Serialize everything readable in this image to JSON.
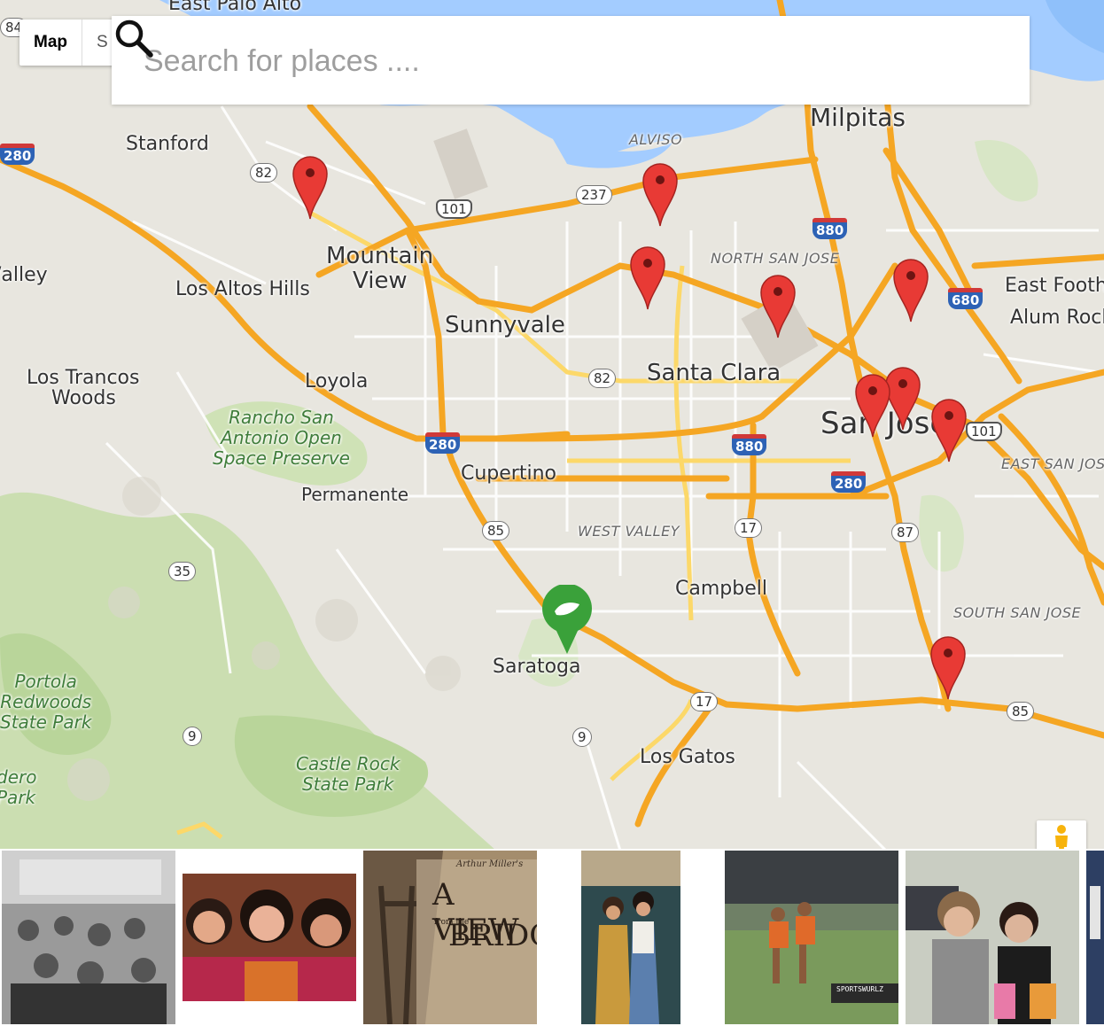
{
  "map_type": {
    "active": "Map",
    "second": "S"
  },
  "search": {
    "placeholder": "Search for places ....",
    "value": ""
  },
  "places": {
    "east_palo_alto": "East Palo Alto",
    "stanford": "Stanford",
    "milpitas": "Milpitas",
    "alviso": "ALVISO",
    "mountain_view_1": "Mountain",
    "mountain_view_2": "View",
    "valley": "/alley",
    "los_altos_hills": "Los Altos Hills",
    "north_san_jose": "NORTH SAN JOSE",
    "east_foothills": "East Foothi",
    "alum_rock": "Alum Rock",
    "sunnyvale": "Sunnyvale",
    "los_trancos_1": "Los Trancos",
    "los_trancos_2": "Woods",
    "loyola": "Loyola",
    "santa_clara": "Santa Clara",
    "rancho": "Rancho San\nAntonio Open\nSpace Preserve",
    "san_jose": "San Jose",
    "east_san_jose": "EAST SAN JOS",
    "cupertino": "Cupertino",
    "permanente": "Permanente",
    "west_valley": "WEST VALLEY",
    "campbell": "Campbell",
    "south_san_jose": "SOUTH SAN JOSE",
    "saratoga": "Saratoga",
    "portola": "Portola\nRedwoods\nState Park",
    "castle_rock": "Castle Rock\nState Park",
    "los_gatos": "Los Gatos",
    "sanborn": "dero\nPark"
  },
  "shields": {
    "s84": "84",
    "s280a": "280",
    "s82a": "82",
    "s101a": "101",
    "s237": "237",
    "s880a": "880",
    "s680": "680",
    "s82b": "82",
    "s280b": "280",
    "s880b": "880",
    "s101b": "101",
    "s280c": "280",
    "s85a": "85",
    "s17a": "17",
    "s87": "87",
    "s35": "35",
    "s17b": "17",
    "s85b": "85",
    "s9a": "9",
    "s9b": "9"
  },
  "markers": [
    {
      "name": "marker-1"
    },
    {
      "name": "marker-2"
    },
    {
      "name": "marker-3"
    },
    {
      "name": "marker-4"
    },
    {
      "name": "marker-5"
    },
    {
      "name": "marker-6"
    },
    {
      "name": "marker-7"
    },
    {
      "name": "marker-8"
    },
    {
      "name": "marker-9"
    }
  ],
  "photos": {
    "theatre_poster_author": "Arthur Miller's",
    "theatre_poster_title_1": "A VIEW",
    "theatre_poster_from": "from the",
    "theatre_poster_title_2": "BRIDGE",
    "soccer_watermark": "SPORTSWURLZ"
  },
  "colors": {
    "highway": "#f5a623",
    "road": "#ffffff",
    "water": "#a3ccff",
    "park": "#c8dfae",
    "marker": "#e83a35",
    "home_marker": "#3aa13a"
  }
}
